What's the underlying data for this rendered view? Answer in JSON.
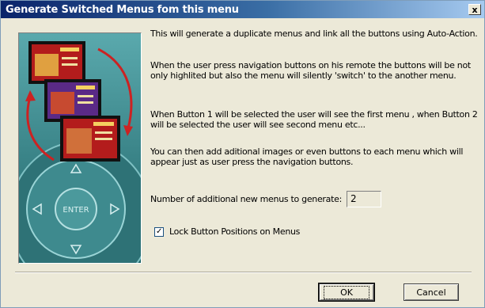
{
  "window": {
    "title": "Generate Switched Menus fom this menu",
    "close_label": "x"
  },
  "image": {
    "menu_cards": [
      "menu-1",
      "menu-2",
      "menu-3"
    ],
    "remote_center_label": "ENTER",
    "colors": {
      "background": "#2c7c80",
      "card_red": "#b31c1c",
      "card_purple": "#5a2a86",
      "arrow": "#cc2222"
    }
  },
  "description": {
    "p1": "This will generate a duplicate menus and link all the buttons using Auto-Action.",
    "p2": "When the user press navigation buttons on his remote the buttons will be not only highlited but also the menu will silently 'switch' to the another menu.",
    "p3": "When Button 1 will be selected the user will see the first menu , when Button 2 will be selected the user will see second menu etc...",
    "p4": "You can then add aditional images or even buttons to each menu which will appear just as user press the navigation buttons."
  },
  "menus_count": {
    "label": "Number of additional new menus to generate:",
    "value": "2"
  },
  "lock_positions": {
    "label": "Lock Button Positions on Menus",
    "checked": true,
    "check_mark": "✓"
  },
  "buttons": {
    "ok_label": "OK",
    "cancel_label": "Cancel"
  }
}
